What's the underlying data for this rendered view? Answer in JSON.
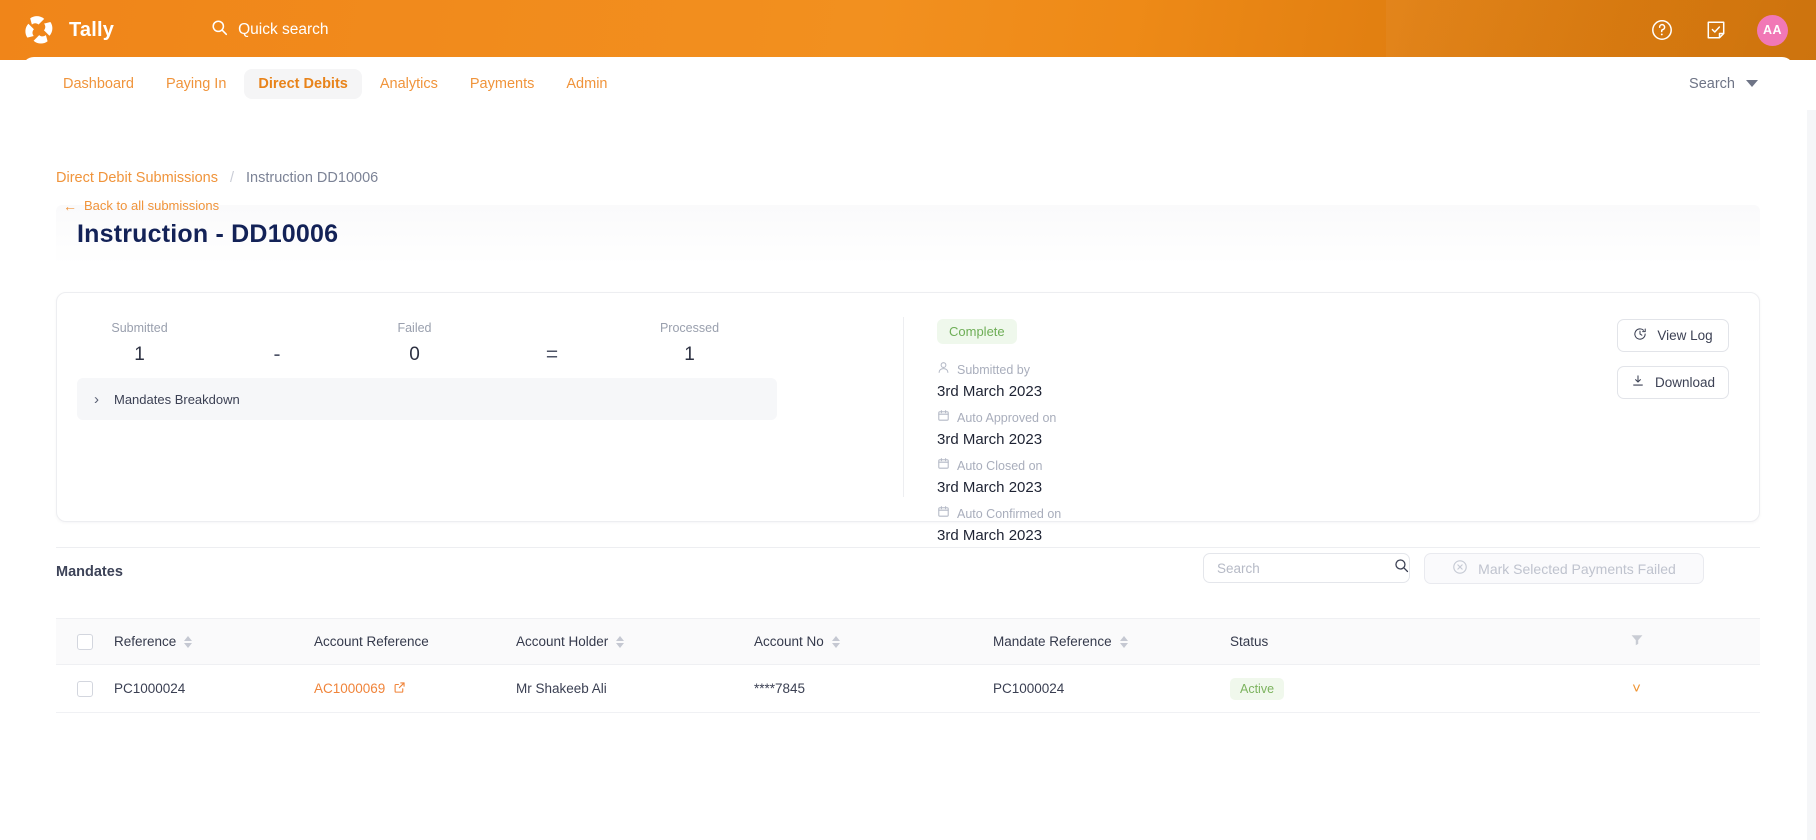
{
  "topbar": {
    "brand_name": "Tally",
    "quick_search_label": "Quick search",
    "help_icon": "question-circle-icon",
    "tasks_icon": "note-check-icon",
    "avatar_initials": "AA",
    "avatar_color": "#F178B6",
    "background_color": "#F08519"
  },
  "nav": {
    "items": [
      {
        "label": "Dashboard",
        "active": false
      },
      {
        "label": "Paying In",
        "active": false
      },
      {
        "label": "Direct Debits",
        "active": true
      },
      {
        "label": "Analytics",
        "active": false
      },
      {
        "label": "Payments",
        "active": false
      },
      {
        "label": "Admin",
        "active": false
      }
    ],
    "search_label": "Search",
    "accent_color": "#F0943B"
  },
  "breadcrumb": {
    "parent": "Direct Debit Submissions",
    "separator": "/",
    "current": "Instruction DD10006"
  },
  "header": {
    "back_label": "Back to all submissions",
    "title": "Instruction - DD10006",
    "title_color": "#132257"
  },
  "summary": {
    "stats": [
      {
        "label": "Submitted",
        "value": "1"
      },
      {
        "label": "Failed",
        "value": "0"
      },
      {
        "label": "Processed",
        "value": "1"
      }
    ],
    "operator_minus": "-",
    "operator_equals": "=",
    "breakdown_label": "Mandates Breakdown",
    "status_badge": "Complete",
    "status_badge_color": "#6EAE56",
    "meta": [
      {
        "icon": "user-icon",
        "label": "Submitted by",
        "value": "3rd March 2023"
      },
      {
        "icon": "calendar-icon",
        "label": "Auto Approved on",
        "value": "3rd March 2023"
      },
      {
        "icon": "calendar-icon",
        "label": "Auto Closed on",
        "value": "3rd March 2023"
      },
      {
        "icon": "calendar-icon",
        "label": "Auto Confirmed on",
        "value": "3rd March 2023"
      }
    ],
    "actions": [
      {
        "label": "View Log",
        "icon": "history-clock-icon"
      },
      {
        "label": "Download",
        "icon": "download-icon"
      }
    ]
  },
  "mandates": {
    "title": "Mandates",
    "search_placeholder": "Search",
    "search_value": "",
    "mark_failed_label": "Mark Selected Payments Failed",
    "mark_failed_disabled": true,
    "columns": [
      {
        "label": "Reference",
        "sortable": true
      },
      {
        "label": "Account Reference",
        "sortable": false
      },
      {
        "label": "Account Holder",
        "sortable": true
      },
      {
        "label": "Account No",
        "sortable": true
      },
      {
        "label": "Mandate Reference",
        "sortable": true
      },
      {
        "label": "Status",
        "sortable": false
      }
    ],
    "filter_icon": "funnel-filter-icon",
    "rows": [
      {
        "selected": false,
        "reference": "PC1000024",
        "account_reference": "AC1000069",
        "account_holder": "Mr Shakeeb Ali",
        "account_no": "****7845",
        "mandate_reference": "PC1000024",
        "status": "Active",
        "expand_icon": "chevron-down-icon"
      }
    ]
  }
}
